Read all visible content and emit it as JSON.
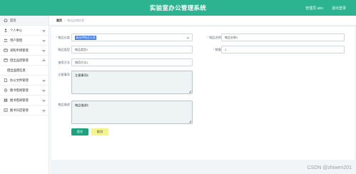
{
  "header": {
    "title": "实验室办公管理系统",
    "user_info": "管理员 abo",
    "logout": "退出登录"
  },
  "colors": {
    "primary": "#2bb48f",
    "submit": "#1aa37e",
    "cancel": "#f4f48a"
  },
  "sidebar": {
    "items": [
      {
        "label": "首页",
        "icon": "home-icon"
      },
      {
        "label": "个人中心",
        "icon": "user-icon"
      },
      {
        "label": "用户管理",
        "icon": "users-icon"
      },
      {
        "label": "采购申请管理",
        "icon": "cart-icon"
      },
      {
        "label": "借出品借管理",
        "icon": "box-icon"
      },
      {
        "label": "办公文件管理",
        "icon": "file-icon"
      },
      {
        "label": "图书借阅管理",
        "icon": "book-icon"
      },
      {
        "label": "图书借阅管理",
        "icon": "grid-icon"
      },
      {
        "label": "图书归还管理",
        "icon": "return-icon"
      }
    ],
    "sub_item": "借出品借信息"
  },
  "breadcrumb": {
    "home": "首页",
    "separator": "/",
    "current": "借出品借信息"
  },
  "form": {
    "field_category_label": "物品分类",
    "field_category_value": "请选择物品分类",
    "field_name_label": "物品名称",
    "field_name_placeholder": "物品名称1",
    "field_type_label": "物品类型",
    "field_type_placeholder": "物品类型1",
    "field_qty_label": "数量",
    "field_qty_value": "1",
    "field_method_label": "借用方法",
    "field_method_placeholder": "借用方法1",
    "field_notes_label": "注意事项",
    "field_notes_value": "注意事项1",
    "field_desc_label": "物品描述",
    "field_desc_value": "物品描述1",
    "submit_label": "提交",
    "cancel_label": "取消"
  },
  "watermark": "CSDN @zhiwen201"
}
